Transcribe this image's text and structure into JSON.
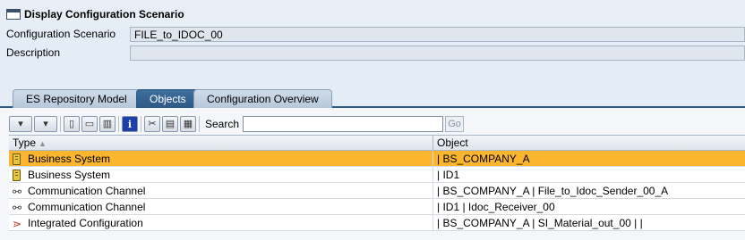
{
  "window": {
    "title": "Display Configuration Scenario",
    "icon": "window-icon"
  },
  "fields": {
    "scenario": {
      "label": "Configuration Scenario",
      "value": "FILE_to_IDOC_00"
    },
    "description": {
      "label": "Description",
      "value": ""
    }
  },
  "tabs": [
    {
      "label": "ES Repository Model",
      "active": false
    },
    {
      "label": "Objects",
      "active": true
    },
    {
      "label": "Configuration Overview",
      "active": false
    }
  ],
  "toolbar": {
    "buttons": [
      "dropdown-menu-icon",
      "dropdown-menu-icon-2",
      "new-object-icon",
      "open-folder-icon",
      "delete-icon",
      "info-icon",
      "cut-icon",
      "copy-icon",
      "paste-icon"
    ],
    "info_glyph": "i",
    "search_label": "Search",
    "search_value": "",
    "go_label": "Go"
  },
  "table": {
    "columns": [
      "Type",
      "Object"
    ],
    "rows": [
      {
        "type": "Business System",
        "icon": "business-system-icon",
        "object": "| BS_COMPANY_A",
        "selected": true
      },
      {
        "type": "Business System",
        "icon": "business-system-icon",
        "object": "| ID1",
        "selected": false
      },
      {
        "type": "Communication Channel",
        "icon": "communication-channel-icon",
        "object": "| BS_COMPANY_A | File_to_Idoc_Sender_00_A",
        "selected": false
      },
      {
        "type": "Communication Channel",
        "icon": "communication-channel-icon",
        "object": "| ID1 | Idoc_Receiver_00",
        "selected": false
      },
      {
        "type": "Integrated Configuration",
        "icon": "integrated-configuration-icon",
        "object": "| BS_COMPANY_A | SI_Material_out_00 | |",
        "selected": false
      }
    ]
  },
  "colors": {
    "selected_row": "#fbb52e",
    "active_tab": "#2d5a87",
    "background": "#e4ecf5"
  }
}
